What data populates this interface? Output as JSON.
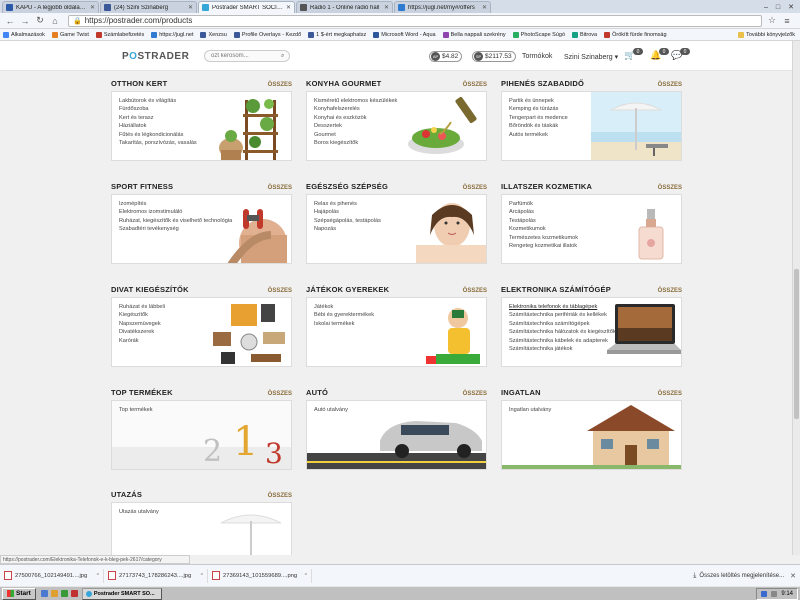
{
  "browser": {
    "tabs": [
      {
        "label": "KAPU - A legjobb oldalak és",
        "icon_color": "#2b5aa8",
        "active": false
      },
      {
        "label": "(24) Szini Szinaberg",
        "icon_color": "#3b5998",
        "active": false
      },
      {
        "label": "Postrader SMART SOCIAL T",
        "icon_color": "#36a6d9",
        "active": true
      },
      {
        "label": "Rádió 1 - Online rádió hall",
        "icon_color": "#555555",
        "active": false
      },
      {
        "label": "https://jugl.net/my#/offers",
        "icon_color": "#2e7bd1",
        "active": false
      }
    ],
    "window_controls": {
      "minimize": "–",
      "maximize": "□",
      "close": "✕"
    },
    "url": "https://postrader.com/products",
    "bookmarks": [
      {
        "label": "Alkalmazások",
        "color": "#4285f4"
      },
      {
        "label": "Game Twist",
        "color": "#e67e22"
      },
      {
        "label": "Számlabefizetés",
        "color": "#c0392b"
      },
      {
        "label": "https://jugl.net",
        "color": "#2e7bd1"
      },
      {
        "label": "Xenzsu",
        "color": "#3b5998"
      },
      {
        "label": "Profile Overlays - Kezdő",
        "color": "#3b5998"
      },
      {
        "label": "1 $-ért megkaphatsz",
        "color": "#3b5998"
      },
      {
        "label": "Microsoft Word - Aqua",
        "color": "#2b579a"
      },
      {
        "label": "Bella nappali szekrény",
        "color": "#8e44ad"
      },
      {
        "label": "PhotoScape Súgó",
        "color": "#27ae60"
      },
      {
        "label": "Bitrova",
        "color": "#16a085"
      },
      {
        "label": "Örökítt fürde finomság",
        "color": "#c0392b"
      }
    ],
    "bookmarks_more": "További könyvjelzők",
    "status_url": "https://postrader.com/Elektronika-Telefonok-e-k-bleg-pek-2617/category"
  },
  "header": {
    "logo_prefix": "P",
    "logo_accent": "O",
    "logo_suffix": "STRADER",
    "search_placeholder": "ozt kerosom...",
    "balance_ap": "$4.82",
    "balance_sp": "$2117.53",
    "ap_label": "AP",
    "sp_label": "SP",
    "link_tormokok": "Tormókok",
    "user_name": "Szini Szinaberg",
    "cart_count": "0",
    "notif_count": "0",
    "msg_count": "0"
  },
  "categories": [
    {
      "title": "OTTHON KERT",
      "all": "ÖSSZES",
      "items": [
        "Lakbútorok és világítás",
        "Fürdőszoba",
        "Kert és terasz",
        "Háziállatok",
        "Fűtés és légkondicionálás",
        "Takarítás, porszívózás, vasalás"
      ],
      "img": "plants",
      "highlight": -1
    },
    {
      "title": "KONYHA GOURMET",
      "all": "ÖSSZES",
      "items": [
        "Kisméretű elektromos készülékek",
        "Konyhafelszerelés",
        "Konyhai és eszközök",
        "Desszertek",
        "Gourmet",
        "Boros kiegészítők"
      ],
      "img": "salad",
      "highlight": -1
    },
    {
      "title": "PIHENÉS SZABADIDŐ",
      "all": "ÖSSZES",
      "items": [
        "Partik és ünnepek",
        "Kemping és túrázás",
        "Tengerpart és medence",
        "Bőröndök és táskák",
        "Autós termékek"
      ],
      "img": "beach",
      "highlight": -1
    },
    {
      "title": "SPORT FITNESS",
      "all": "ÖSSZES",
      "items": [
        "Izomépítés",
        "Elektromos izomstimuláló",
        "Ruházat, kiegészítők és viselhető technológia",
        "Szabadtéri tevékenység"
      ],
      "img": "fitness",
      "highlight": -1
    },
    {
      "title": "EGÉSZSÉG SZÉPSÉG",
      "all": "ÖSSZES",
      "items": [
        "Relax és pihenés",
        "Hajápolás",
        "Szépségápolás, testápolás",
        "Napozás"
      ],
      "img": "beauty",
      "highlight": -1
    },
    {
      "title": "ILLATSZER KOZMETIKA",
      "all": "ÖSSZES",
      "items": [
        "Parfümök",
        "Arcápolás",
        "Testápolás",
        "Kozmetikumok",
        "Természetes kozmetikumok",
        "Rengeteg kozmetikai illatok"
      ],
      "img": "perfume",
      "highlight": -1
    },
    {
      "title": "DIVAT KIEGÉSZÍTŐK",
      "all": "ÖSSZES",
      "items": [
        "Ruházat és lábbeli",
        "Kiegészítők",
        "Napszemüvegek",
        "Divatékszerek",
        "Karórák"
      ],
      "img": "fashion",
      "highlight": -1
    },
    {
      "title": "JÁTÉKOK GYEREKEK",
      "all": "ÖSSZES",
      "items": [
        "Játékok",
        "Bébi és gyerektermékek",
        "Iskolai termékek"
      ],
      "img": "kid",
      "highlight": -1
    },
    {
      "title": "ELEKTRONIKA SZÁMÍTÓGÉP",
      "all": "ÖSSZES",
      "items": [
        "Elektronika telefonok és táblagépek",
        "Számítástechnika perifériák és kellékek",
        "Számítástechnika számítógépek",
        "Számítástechnika hálózatok és kiegészítők",
        "Számítástechnika kábelek és adapterek",
        "Számítástechnika játékok"
      ],
      "img": "laptop",
      "highlight": 0
    },
    {
      "title": "TOP TERMÉKEK",
      "all": "ÖSSZES",
      "items": [
        "Top termékek"
      ],
      "img": "podium",
      "highlight": -1
    },
    {
      "title": "AUTÓ",
      "all": "ÖSSZES",
      "items": [
        "Autó utalvány"
      ],
      "img": "car",
      "highlight": -1
    },
    {
      "title": "INGATLAN",
      "all": "ÖSSZES",
      "items": [
        "Ingatlan utalvány"
      ],
      "img": "house",
      "highlight": -1
    },
    {
      "title": "UTAZÁS",
      "all": "ÖSSZES",
      "items": [
        "Utazás utalvány"
      ],
      "img": "travel",
      "highlight": -1
    }
  ],
  "downloads": {
    "items": [
      "27500766_102149491....jpg",
      "27173743_178286243....jpg",
      "27369143_101559689....png"
    ],
    "show_all": "Összes letöltés megjelenítése..."
  },
  "taskbar": {
    "start": "Start",
    "window": "Postrader SMART SO...",
    "clock": "9:14"
  },
  "colors": {
    "accent": "#36a6d9",
    "all_link": "#8a6d3b"
  }
}
